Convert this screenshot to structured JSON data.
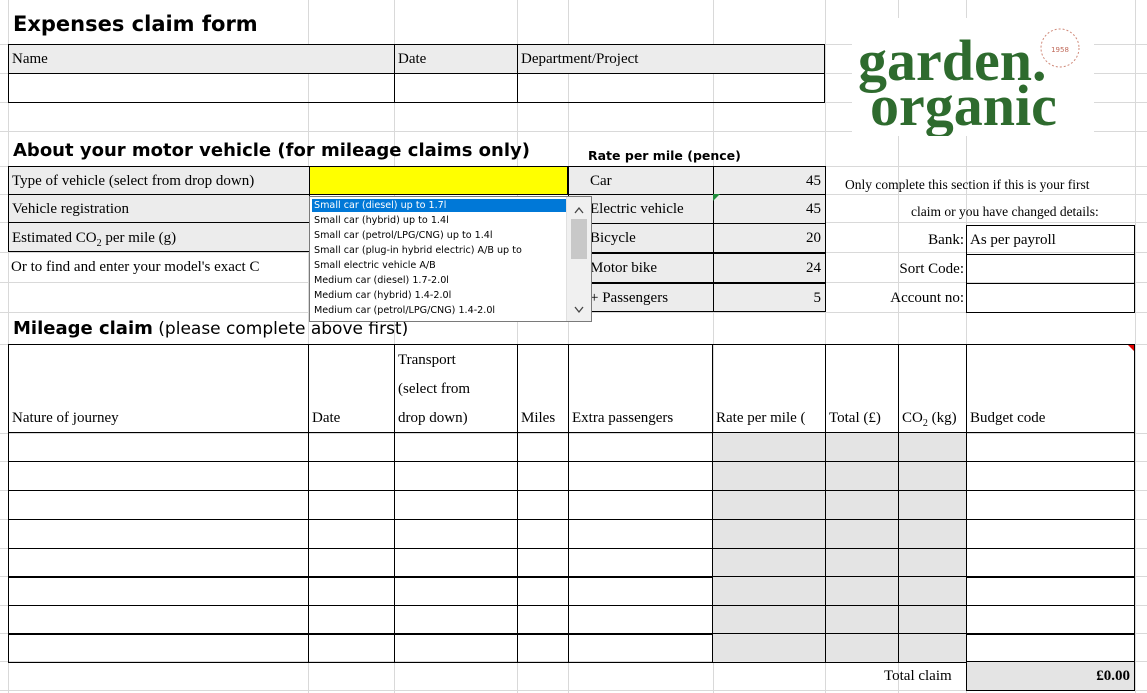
{
  "form_title": "Expenses claim form",
  "header": {
    "name_label": "Name",
    "date_label": "Date",
    "department_label": "Department/Project"
  },
  "logo": {
    "text": "garden organic",
    "word1": "garden",
    "word2": "organic",
    "dot": ".",
    "stamp": "organic pioneers 1958",
    "color": "#2e6b2e"
  },
  "vehicle": {
    "heading": "About your motor vehicle (for mileage claims only)",
    "type_label": "Type of vehicle (select from drop down)",
    "registration_label": "Vehicle registration",
    "co2_label_pre": "Estimated CO",
    "co2_label_sub": "2",
    "co2_label_post": " per mile (g)",
    "find_label": "Or to find and enter your model's exact C",
    "type_value_color": "#ffff00",
    "dropdown_options": [
      "Small car (diesel) up to 1.7l",
      "Small car (hybrid) up to 1.4l",
      "Small car (petrol/LPG/CNG) up to 1.4l",
      "Small car (plug-in hybrid electric) A/B up to",
      "Small electric vehicle A/B",
      "Medium car (diesel) 1.7-2.0l",
      "Medium car (hybrid) 1.4-2.0l",
      "Medium car (petrol/LPG/CNG) 1.4-2.0l"
    ],
    "selected_index": 0
  },
  "rates": {
    "heading": "Rate per mile (pence)",
    "rows": [
      {
        "label": "Car",
        "value": "45"
      },
      {
        "label": "Electric vehicle",
        "value": "45"
      },
      {
        "label": "Bicycle",
        "value": "20"
      },
      {
        "label": "Motor bike",
        "value": "24"
      },
      {
        "label": "+ Passengers",
        "value": "5"
      }
    ]
  },
  "bank": {
    "note_line1": "Only complete this section if this is your first",
    "note_line2": "claim or you have changed details:",
    "bank_label": "Bank:",
    "bank_value": "As per payroll",
    "sort_label": "Sort Code:",
    "account_label": "Account no:"
  },
  "mileage": {
    "heading": "Mileage claim",
    "heading_note": " (please complete above first)",
    "columns": {
      "journey": "Nature of journey",
      "date": "Date",
      "transport_1": "Transport",
      "transport_2": "(select from",
      "transport_3": "drop down)",
      "miles": "Miles",
      "passengers": "Extra passengers",
      "rate": "Rate per mile (",
      "total": "Total (£)",
      "co2_pre": "CO",
      "co2_sub": "2",
      "co2_post": " (kg)",
      "budget": "Budget code"
    },
    "total_label": "Total claim",
    "total_value": "£0.00"
  }
}
